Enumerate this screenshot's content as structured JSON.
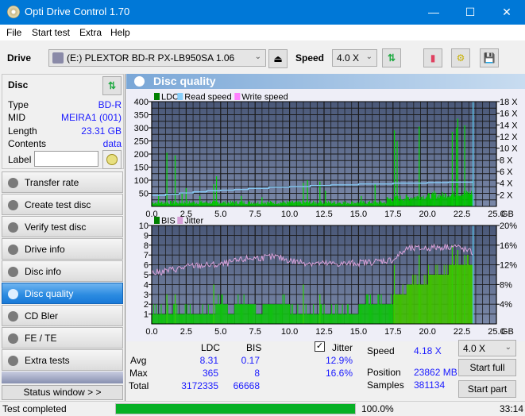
{
  "window": {
    "title": "Opti Drive Control 1.70",
    "minimize": "—",
    "maximize": "☐",
    "close": "✕"
  },
  "menu": [
    "File",
    "Start test",
    "Extra",
    "Help"
  ],
  "toolbar": {
    "drive_label": "Drive",
    "drive_value": "(E:)  PLEXTOR BD-R  PX-LB950SA 1.06",
    "speed_label": "Speed",
    "speed_value": "4.0 X"
  },
  "disc": {
    "header": "Disc",
    "rows": [
      {
        "k": "Type",
        "v": "BD-R"
      },
      {
        "k": "MID",
        "v": "MEIRA1 (001)"
      },
      {
        "k": "Length",
        "v": "23.31 GB"
      },
      {
        "k": "Contents",
        "v": "data"
      }
    ],
    "label_key": "Label",
    "label_value": ""
  },
  "nav": [
    {
      "label": "Transfer rate",
      "active": false
    },
    {
      "label": "Create test disc",
      "active": false
    },
    {
      "label": "Verify test disc",
      "active": false
    },
    {
      "label": "Drive info",
      "active": false
    },
    {
      "label": "Disc info",
      "active": false
    },
    {
      "label": "Disc quality",
      "active": true
    },
    {
      "label": "CD Bler",
      "active": false
    },
    {
      "label": "FE / TE",
      "active": false
    },
    {
      "label": "Extra tests",
      "active": false
    }
  ],
  "status_window_btn": "Status window > >",
  "panel_title": "Disc quality",
  "chart_data": [
    {
      "type": "bar",
      "title": "LDC",
      "legend": [
        "LDC",
        "Read speed",
        "Write speed"
      ],
      "legend_colors": [
        "#008000",
        "#87cefa",
        "#ff80ff"
      ],
      "xlabel": "GB",
      "x_ticks": [
        "0.0",
        "2.5",
        "5.0",
        "7.5",
        "10.0",
        "12.5",
        "15.0",
        "17.5",
        "20.0",
        "22.5",
        "25.0"
      ],
      "xlim": [
        0,
        25
      ],
      "ylim": [
        0,
        400
      ],
      "y_ticks": [
        50,
        100,
        150,
        200,
        250,
        300,
        350,
        400
      ],
      "y2lim": [
        0,
        18
      ],
      "y2_ticks": [
        "2 X",
        "4 X",
        "6 X",
        "8 X",
        "10 X",
        "12 X",
        "14 X",
        "16 X",
        "18 X"
      ],
      "grid": true,
      "peaks": [
        [
          0.5,
          40
        ],
        [
          1.1,
          205
        ],
        [
          1.7,
          195
        ],
        [
          2.2,
          50
        ],
        [
          2.5,
          70
        ],
        [
          3.5,
          40
        ],
        [
          4.5,
          85
        ],
        [
          4.7,
          115
        ],
        [
          6.5,
          40
        ],
        [
          8.0,
          35
        ],
        [
          11.0,
          90
        ],
        [
          11.3,
          100
        ],
        [
          12.2,
          95
        ],
        [
          12.6,
          60
        ],
        [
          15.2,
          40
        ],
        [
          16.2,
          85
        ],
        [
          17.6,
          290
        ],
        [
          17.8,
          250
        ],
        [
          19.4,
          305
        ],
        [
          20.5,
          60
        ],
        [
          21.8,
          285
        ],
        [
          22.1,
          300
        ],
        [
          22.2,
          335
        ],
        [
          22.7,
          310
        ],
        [
          23.3,
          100
        ]
      ],
      "read_speed": [
        [
          0,
          1.9
        ],
        [
          1.0,
          2.1
        ],
        [
          2.0,
          2.3
        ],
        [
          3.0,
          2.5
        ],
        [
          4.0,
          2.7
        ],
        [
          5.0,
          2.8
        ],
        [
          6.0,
          2.9
        ],
        [
          7.0,
          3.1
        ],
        [
          8.5,
          3.3
        ],
        [
          10.0,
          3.4
        ],
        [
          11.5,
          3.6
        ],
        [
          13.0,
          3.7
        ],
        [
          15.0,
          3.85
        ],
        [
          17.5,
          4.0
        ],
        [
          20.0,
          4.1
        ],
        [
          21.5,
          4.18
        ],
        [
          23.3,
          4.18
        ]
      ],
      "end_marker": 23.31
    },
    {
      "type": "bar",
      "title": "BIS",
      "legend": [
        "BIS",
        "Jitter"
      ],
      "legend_colors": [
        "#008000",
        "#d8a0d8"
      ],
      "xlabel": "GB",
      "x_ticks": [
        "0.0",
        "2.5",
        "5.0",
        "7.5",
        "10.0",
        "12.5",
        "15.0",
        "17.5",
        "20.0",
        "22.5",
        "25.0"
      ],
      "xlim": [
        0,
        25
      ],
      "ylim": [
        0,
        10
      ],
      "y_ticks": [
        1,
        2,
        3,
        4,
        5,
        6,
        7,
        8,
        9,
        10
      ],
      "y2lim": [
        0,
        20
      ],
      "y2_ticks": [
        "4%",
        "8%",
        "12%",
        "16%",
        "20%"
      ],
      "grid": true,
      "bis_base": [
        [
          0,
          1
        ],
        [
          4.5,
          1
        ],
        [
          4.6,
          2
        ],
        [
          5.5,
          1
        ],
        [
          6.0,
          2
        ],
        [
          7.5,
          1
        ],
        [
          8.0,
          2
        ],
        [
          10.0,
          1
        ],
        [
          15.0,
          2
        ],
        [
          17.5,
          3
        ],
        [
          18.5,
          4
        ],
        [
          20.0,
          5
        ],
        [
          21.5,
          6
        ],
        [
          23.3,
          6
        ]
      ],
      "bis_peaks": [
        [
          1.1,
          3
        ],
        [
          1.7,
          3
        ],
        [
          4.5,
          4
        ],
        [
          11.0,
          4
        ],
        [
          12.2,
          3
        ],
        [
          17.6,
          6
        ],
        [
          19.4,
          7
        ],
        [
          21.8,
          8
        ],
        [
          22.2,
          7.5
        ],
        [
          22.7,
          7
        ]
      ],
      "jitter": [
        [
          0,
          10.3
        ],
        [
          1.5,
          11.0
        ],
        [
          3.0,
          11.8
        ],
        [
          5.0,
          12.0
        ],
        [
          7.0,
          13.3
        ],
        [
          9.0,
          13.6
        ],
        [
          10.5,
          12.6
        ],
        [
          12.5,
          12.2
        ],
        [
          14.0,
          12.2
        ],
        [
          16.0,
          12.6
        ],
        [
          17.5,
          13.0
        ],
        [
          18.5,
          15.2
        ],
        [
          20.0,
          15.4
        ],
        [
          22.0,
          15.8
        ],
        [
          23.3,
          14.4
        ]
      ],
      "end_marker": 23.31
    }
  ],
  "stats": {
    "col_ldc": "LDC",
    "col_bis": "BIS",
    "jitter_label": "Jitter",
    "jitter_checked": true,
    "avg_label": "Avg",
    "max_label": "Max",
    "total_label": "Total",
    "ldc_avg": "8.31",
    "ldc_max": "365",
    "ldc_total": "3172335",
    "bis_avg": "0.17",
    "bis_max": "8",
    "bis_total": "66668",
    "jit_avg": "12.9%",
    "jit_max": "16.6%",
    "speed_label": "Speed",
    "speed_value": "4.18 X",
    "position_label": "Position",
    "position_value": "23862 MB",
    "samples_label": "Samples",
    "samples_value": "381134",
    "speed_select": "4.0 X",
    "start_full": "Start full",
    "start_part": "Start part"
  },
  "statusbar": {
    "text": "Test completed",
    "progress": 100.0,
    "percent": "100.0%",
    "time": "33:14"
  }
}
